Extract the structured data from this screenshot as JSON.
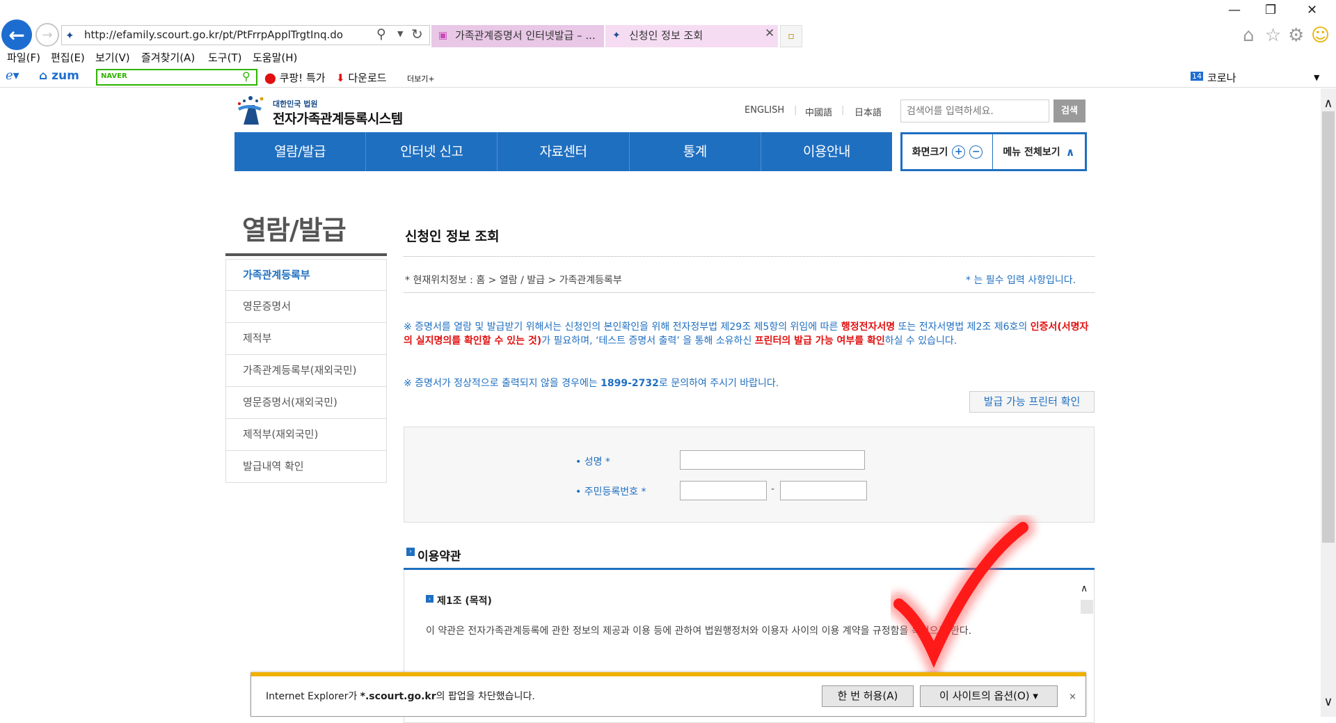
{
  "browser": {
    "url": "http://efamily.scourt.go.kr/pt/PtFrrpApplTrgtInq.do",
    "tabs": [
      {
        "label": "가족관계증명서 인터넷발급 – ..."
      },
      {
        "label": "신청인 정보 조회"
      }
    ],
    "menu": [
      "파일(F)",
      "편집(E)",
      "보기(V)",
      "즐겨찾기(A)",
      "도구(T)",
      "도움말(H)"
    ],
    "favorites": {
      "zum": "zum",
      "naver_label": "NAVER",
      "coupang": "쿠팡! 특가",
      "download": "다운로드",
      "more": "더보기+",
      "corona_num": "14",
      "corona": "코로나"
    }
  },
  "site": {
    "logo_small": "대한민국 법원",
    "logo_big": "전자가족관계등록시스템",
    "languages": [
      "ENGLISH",
      "中國語",
      "日本語"
    ],
    "search_placeholder": "검색어를 입력하세요.",
    "search_button": "검색",
    "gnb": [
      "열람/발급",
      "인터넷 신고",
      "자료센터",
      "통계",
      "이용안내"
    ],
    "zoom_label": "화면크기",
    "menu_all_label": "메뉴 전체보기"
  },
  "sidebar": {
    "title": "열람/발급",
    "items": [
      {
        "label": "가족관계등록부",
        "active": true
      },
      {
        "label": "영문증명서"
      },
      {
        "label": "제적부"
      },
      {
        "label": "가족관계등록부(재외국민)"
      },
      {
        "label": "영문증명서(재외국민)"
      },
      {
        "label": "제적부(재외국민)"
      },
      {
        "label": "발급내역 확인"
      }
    ]
  },
  "content": {
    "title": "신청인 정보 조회",
    "breadcrumb": "* 현재위치정보 : 홈 > 열람 / 발급 > 가족관계등록부",
    "required_note": "* 는 필수 입력 사항입니다.",
    "notice1_a": "※ 증명서를 열람 및 발급받기 위해서는 신청인의 본인확인을 위해 전자정부법 제29조 제5항의 위임에 따른 ",
    "notice1_red1": "행정전자서명",
    "notice1_b": " 또는 전자서명법 제2조 제6호의 ",
    "notice1_red2": "인증서(서명자의 실지명의를 확인할 수 있는 것)",
    "notice1_c": "가 필요하며, ‘테스트 증명서 출력’ 을 통해 소유하신 ",
    "notice1_red3": "프린터의 발급 가능 여부를 확인",
    "notice1_d": "하실 수 있습니다.",
    "notice2_a": "※ 증명서가 정상적으로 출력되지 않을 경우에는 ",
    "notice2_phone": "1899-2732",
    "notice2_b": "로 문의하여 주시기 바랍니다.",
    "printer_button": "발급 가능 프린터 확인",
    "form": {
      "name_label": "• 성명 *",
      "rrn_label": "• 주민등록번호 *",
      "rrn_dash": "-"
    },
    "terms_title": "이용약관",
    "terms_article": "제1조 (목적)",
    "terms_text": "이 약관은 전자가족관계등록에 관한 정보의 제공과 이용 등에 관하여 법원행정처와 이용자 사이의 이용 계약을 규정함을 목적으로 한다."
  },
  "notification": {
    "text_a": "Internet Explorer가 ",
    "text_site": "*.scourt.go.kr",
    "text_b": "의 팝업을 차단했습니다.",
    "allow_once": "한 번 허용(A)",
    "site_options": "이 사이트의 옵션(O) ▾",
    "close": "×"
  },
  "colors": {
    "brand_blue": "#1f6fc0",
    "notice_red": "#e01010",
    "notif_bar": "#f0b000",
    "check_red": "#ff1a1a"
  }
}
